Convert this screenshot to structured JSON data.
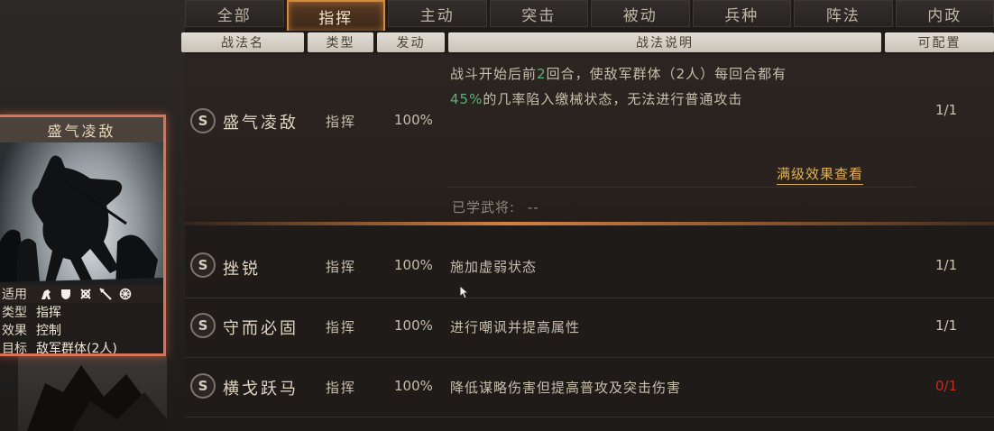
{
  "tabs": [
    {
      "label": "全部",
      "active": false
    },
    {
      "label": "指挥",
      "active": true
    },
    {
      "label": "主动",
      "active": false
    },
    {
      "label": "突击",
      "active": false
    },
    {
      "label": "被动",
      "active": false
    },
    {
      "label": "兵种",
      "active": false
    },
    {
      "label": "阵法",
      "active": false
    },
    {
      "label": "内政",
      "active": false
    }
  ],
  "columns": {
    "name": "战法名",
    "type": "类型",
    "trigger": "发动",
    "desc": "战法说明",
    "config": "可配置"
  },
  "selected": {
    "badge": "S",
    "name": "盛气凌敌",
    "type": "指挥",
    "pct": "100%",
    "desc_line1_a": "战斗开始后前",
    "desc_line1_num": "2",
    "desc_line1_b": "回合，使敌军群体（2人）每回合都有",
    "desc_line2_num": "45%",
    "desc_line2_b": "的几率陷入缴械状态，无法进行普通攻击",
    "count": "1/1",
    "max_effect_link": "满级效果查看",
    "learned_label": "已学武将:",
    "learned_value": "--"
  },
  "rows": [
    {
      "badge": "S",
      "name": "挫锐",
      "type": "指挥",
      "pct": "100%",
      "desc": "施加虚弱状态",
      "count": "1/1",
      "count_color": "normal"
    },
    {
      "badge": "S",
      "name": "守而必固",
      "type": "指挥",
      "pct": "100%",
      "desc": "进行嘲讽并提高属性",
      "count": "1/1",
      "count_color": "normal"
    },
    {
      "badge": "S",
      "name": "横戈跃马",
      "type": "指挥",
      "pct": "100%",
      "desc": "降低谋略伤害但提高普攻及突击伤害",
      "count": "0/1",
      "count_color": "red"
    }
  ],
  "card": {
    "title": "盛气凌敌",
    "use_label": "适用",
    "type_label": "类型",
    "type_value": "指挥",
    "effect_label": "效果",
    "effect_value": "控制",
    "target_label": "目标",
    "target_value": "敌军群体(2人)",
    "troop_icons": [
      "cavalry-icon",
      "shield-icon",
      "bow-icon",
      "spear-icon",
      "siege-icon"
    ]
  },
  "colors": {
    "accent": "#d48a3c",
    "green": "#5fb07a",
    "red": "#c22e22"
  }
}
